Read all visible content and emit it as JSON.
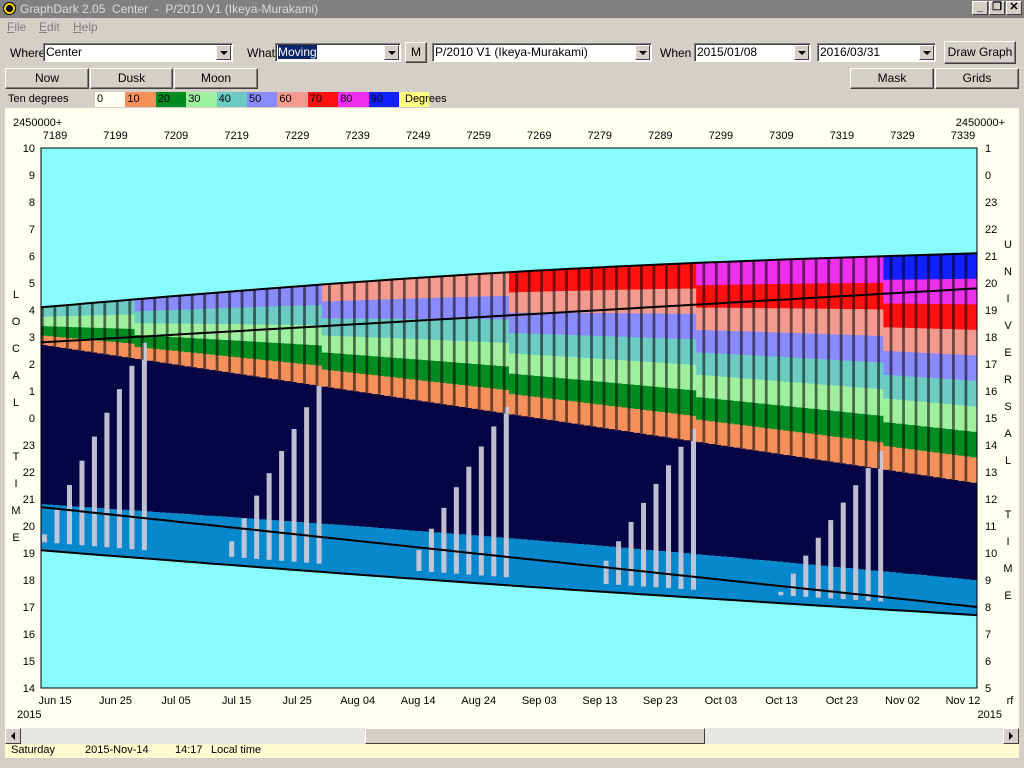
{
  "window": {
    "title": "GraphDark 2.05  Center  -  P/2010 V1 (Ikeya-Murakami)",
    "controls": {
      "minimize": "_",
      "restore": "❐",
      "close": "✕"
    }
  },
  "menu": [
    "File",
    "Edit",
    "Help"
  ],
  "toolbar": {
    "where_label": "Where",
    "where_value": "Center",
    "what_label": "What",
    "what_value": "Moving",
    "m_button": "M",
    "object_value": "P/2010 V1 (Ikeya-Murakami)",
    "when_label": "When",
    "start_date": "2015/01/08",
    "end_date": "2016/03/31",
    "draw_button": "Draw Graph"
  },
  "buttons": {
    "now": "Now",
    "dusk": "Dusk",
    "moon": "Moon",
    "mask": "Mask",
    "grids": "Grids"
  },
  "legend": {
    "prefix": "Ten degrees",
    "suffix": "Degrees",
    "swatches": [
      {
        "label": "0",
        "color": "#fffff0"
      },
      {
        "label": "10",
        "color": "#f5905a"
      },
      {
        "label": "20",
        "color": "#008c20"
      },
      {
        "label": "30",
        "color": "#9ef09e"
      },
      {
        "label": "40",
        "color": "#6ccbc3"
      },
      {
        "label": "50",
        "color": "#8a8aff"
      },
      {
        "label": "60",
        "color": "#f59a8e"
      },
      {
        "label": "70",
        "color": "#ff1010"
      },
      {
        "label": "80",
        "color": "#ee30ee"
      },
      {
        "label": "90",
        "color": "#1020ff"
      },
      {
        "label": "",
        "color": "#ffff80"
      }
    ]
  },
  "chart_data": {
    "type": "area",
    "title": "",
    "top_axis": {
      "prefix_left": "2450000+",
      "prefix_right": "2450000+",
      "ticks": [
        "7189",
        "7199",
        "7209",
        "7219",
        "7229",
        "7239",
        "7249",
        "7259",
        "7269",
        "7279",
        "7289",
        "7299",
        "7309",
        "7319",
        "7329",
        "7339"
      ]
    },
    "bottom_axis": {
      "ticks": [
        "Jun 15",
        "Jun 25",
        "Jul 05",
        "Jul 15",
        "Jul 25",
        "Aug 04",
        "Aug 14",
        "Aug 24",
        "Sep 03",
        "Sep 13",
        "Sep 23",
        "Oct 03",
        "Oct 13",
        "Oct 23",
        "Nov 02",
        "Nov 12"
      ],
      "year_left": "2015",
      "year_right": "2015",
      "corner_right": "rf"
    },
    "left_axis": {
      "ticks": [
        "10",
        "9",
        "8",
        "7",
        "6",
        "5",
        "4",
        "3",
        "2",
        "1",
        "0",
        "23",
        "22",
        "21",
        "20",
        "19",
        "18",
        "17",
        "16",
        "15",
        "14"
      ],
      "label_letters": [
        "L",
        "O",
        "C",
        "A",
        "L",
        "",
        "T",
        "I",
        "M",
        "E"
      ]
    },
    "right_axis": {
      "ticks": [
        "1",
        "0",
        "23",
        "22",
        "21",
        "20",
        "19",
        "18",
        "17",
        "16",
        "15",
        "14",
        "13",
        "12",
        "11",
        "10",
        "9",
        "8",
        "7",
        "6",
        "5"
      ],
      "label_letters": [
        "U",
        "N",
        "I",
        "V",
        "E",
        "R",
        "S",
        "A",
        "L",
        "",
        "T",
        "I",
        "M",
        "E"
      ]
    },
    "colors": {
      "sky_day": "#88fcfc",
      "twilight": "#0888cc",
      "night": "#050545",
      "moon": "#c8c8d8",
      "bands": [
        "#f5905a",
        "#008c20",
        "#9ef09e",
        "#6ccbc3",
        "#8a8aff",
        "#f59a8e",
        "#ff1010",
        "#ee30ee",
        "#1020ff"
      ]
    }
  },
  "status": {
    "day": "Saturday",
    "date": "2015-Nov-14",
    "time": "14:17",
    "zone": "Local time"
  }
}
